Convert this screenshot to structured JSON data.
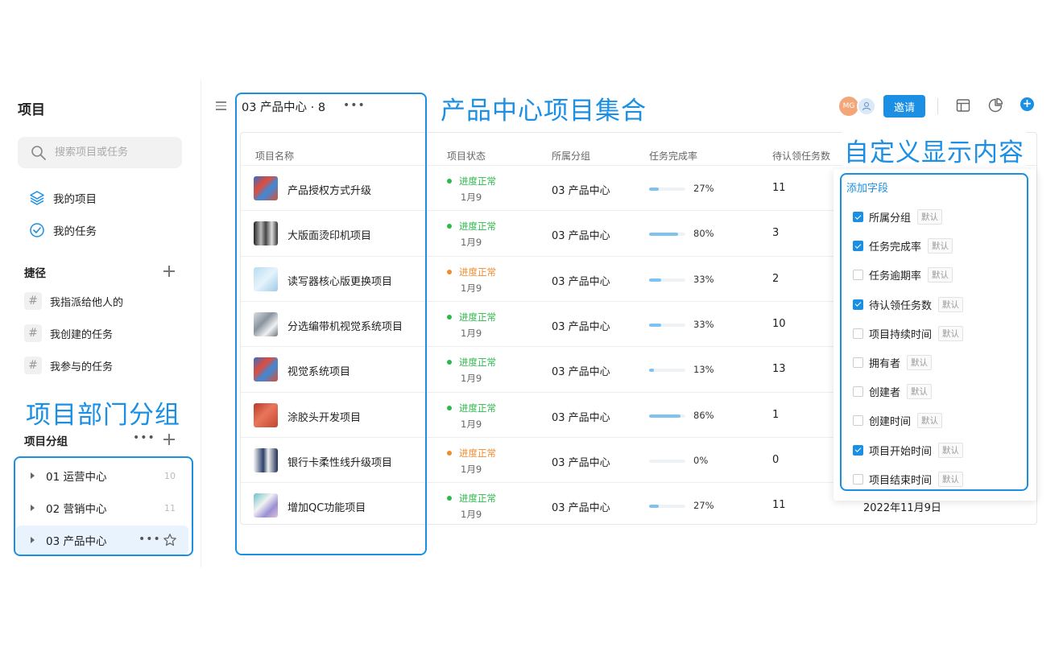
{
  "sidebar": {
    "title": "项目",
    "search_placeholder": "搜索项目或任务",
    "nav": [
      {
        "label": "我的项目",
        "icon": "layers-icon"
      },
      {
        "label": "我的任务",
        "icon": "check-circle-icon"
      }
    ],
    "shortcuts_title": "捷径",
    "shortcuts": [
      "我指派给他人的",
      "我创建的任务",
      "我参与的任务"
    ],
    "annotation": "项目部门分组",
    "groups_title": "项目分组",
    "groups": [
      {
        "label": "01 运营中心",
        "count": "10"
      },
      {
        "label": "02 营销中心",
        "count": "11"
      },
      {
        "label": "03 产品中心",
        "count": ""
      }
    ]
  },
  "header": {
    "title": "03 产品中心 · 8",
    "annotation": "产品中心项目集合",
    "avatar_initials": "MG",
    "invite_label": "邀请"
  },
  "table": {
    "columns": [
      "项目名称",
      "项目状态",
      "所属分组",
      "任务完成率",
      "待认领任务数"
    ],
    "rows": [
      {
        "name": "产品授权方式升级",
        "status": "进度正常",
        "status_color": "#2db84c",
        "date": "1月9",
        "group": "03 产品中心",
        "progress": 27,
        "progress_label": "27%",
        "pending": "11",
        "extra": ""
      },
      {
        "name": "大版面烫印机项目",
        "status": "进度正常",
        "status_color": "#2db84c",
        "date": "1月9",
        "group": "03 产品中心",
        "progress": 80,
        "progress_label": "80%",
        "pending": "3",
        "extra": ""
      },
      {
        "name": "读写器核心版更换项目",
        "status": "进度正常",
        "status_color": "#f08c2e",
        "date": "1月9",
        "group": "03 产品中心",
        "progress": 33,
        "progress_label": "33%",
        "pending": "2",
        "extra": ""
      },
      {
        "name": "分选编带机视觉系统项目",
        "status": "进度正常",
        "status_color": "#2db84c",
        "date": "1月9",
        "group": "03 产品中心",
        "progress": 33,
        "progress_label": "33%",
        "pending": "10",
        "extra": ""
      },
      {
        "name": "视觉系统项目",
        "status": "进度正常",
        "status_color": "#2db84c",
        "date": "1月9",
        "group": "03 产品中心",
        "progress": 13,
        "progress_label": "13%",
        "pending": "13",
        "extra": ""
      },
      {
        "name": "涂胶头开发项目",
        "status": "进度正常",
        "status_color": "#2db84c",
        "date": "1月9",
        "group": "03 产品中心",
        "progress": 86,
        "progress_label": "86%",
        "pending": "1",
        "extra": ""
      },
      {
        "name": "银行卡柔性线升级项目",
        "status": "进度正常",
        "status_color": "#f08c2e",
        "date": "1月9",
        "group": "03 产品中心",
        "progress": 0,
        "progress_label": "0%",
        "pending": "0",
        "extra": ""
      },
      {
        "name": "增加QC功能项目",
        "status": "进度正常",
        "status_color": "#2db84c",
        "date": "1月9",
        "group": "03 产品中心",
        "progress": 27,
        "progress_label": "27%",
        "pending": "11",
        "extra": "2022年11月9日"
      }
    ]
  },
  "fields_panel": {
    "annotation": "自定义显示内容",
    "add_label": "添加字段",
    "default_tag": "默认",
    "fields": [
      {
        "label": "所属分组",
        "checked": true
      },
      {
        "label": "任务完成率",
        "checked": true
      },
      {
        "label": "任务逾期率",
        "checked": false
      },
      {
        "label": "待认领任务数",
        "checked": true
      },
      {
        "label": "项目持续时间",
        "checked": false
      },
      {
        "label": "拥有者",
        "checked": false
      },
      {
        "label": "创建者",
        "checked": false
      },
      {
        "label": "创建时间",
        "checked": false
      },
      {
        "label": "项目开始时间",
        "checked": true
      },
      {
        "label": "项目结束时间",
        "checked": false
      }
    ]
  },
  "colors": {
    "accent": "#1a8fe3",
    "status_normal": "#2db84c",
    "status_warning": "#f08c2e"
  }
}
